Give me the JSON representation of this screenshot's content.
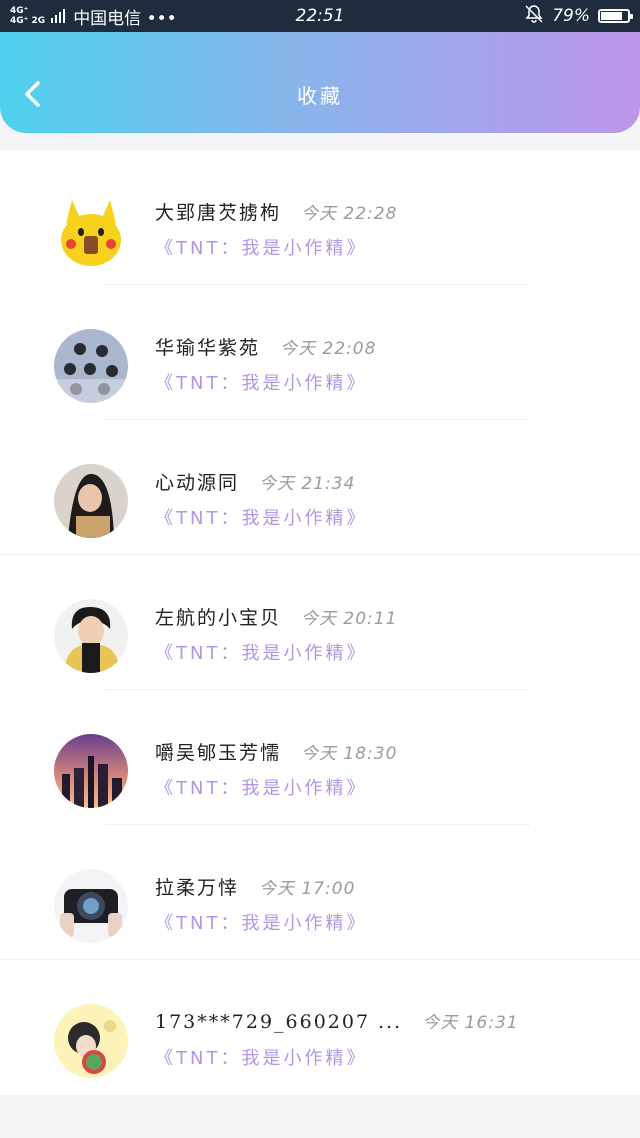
{
  "status_bar": {
    "network_1": "4G⁺",
    "network_2": "4G⁺ 2G",
    "carrier": "中国电信 •••",
    "time": "22:51",
    "battery_text": "79%",
    "battery_level": 0.79
  },
  "header": {
    "title": "收藏"
  },
  "favorites": [
    {
      "name": "大郢唐芡掳枸",
      "time": "今天 22:28",
      "subtitle": "《TNT：我是小作精》"
    },
    {
      "name": "华瑜华紫苑",
      "time": "今天 22:08",
      "subtitle": "《TNT：我是小作精》"
    },
    {
      "name": "心动源同",
      "time": "今天 21:34",
      "subtitle": "《TNT：我是小作精》"
    },
    {
      "name": "左航的小宝贝",
      "time": "今天 20:11",
      "subtitle": "《TNT：我是小作精》"
    },
    {
      "name": "嚼吴郇玉芳懦",
      "time": "今天 18:30",
      "subtitle": "《TNT：我是小作精》"
    },
    {
      "name": "拉柔万悻",
      "time": "今天 17:00",
      "subtitle": "《TNT：我是小作精》"
    },
    {
      "name": "173***729_660207 ...",
      "time": "今天 16:31",
      "subtitle": "《TNT：我是小作精》"
    }
  ]
}
